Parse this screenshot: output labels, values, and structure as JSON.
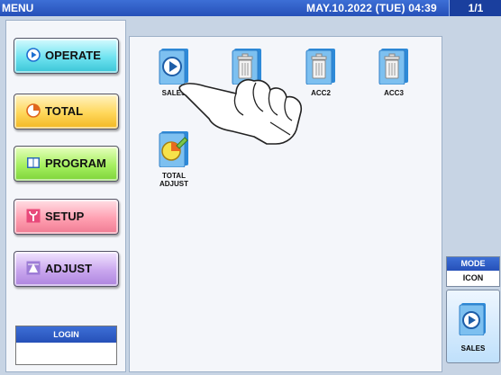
{
  "titlebar": {
    "menu_label": "MENU",
    "datetime": "MAY.10.2022 (TUE) 04:39",
    "page": "1/1"
  },
  "menu_buttons": {
    "operate": "OPERATE",
    "total": "TOTAL",
    "program": "PROGRAM",
    "setup": "SETUP",
    "adjust": "ADJUST"
  },
  "login": {
    "label": "LOGIN",
    "value": ""
  },
  "apps": [
    {
      "label": "SALES",
      "icon": "sales-play-icon"
    },
    {
      "label": "",
      "icon": "trash-icon"
    },
    {
      "label": "ACC2",
      "icon": "trash-icon"
    },
    {
      "label": "ACC3",
      "icon": "trash-icon"
    },
    {
      "label": "TOTAL\nADJUST",
      "icon": "pie-chart-pencil-icon"
    }
  ],
  "mode": {
    "label": "MODE",
    "value": "ICON"
  },
  "shortcut": {
    "label": "SALES",
    "icon": "sales-play-icon"
  },
  "colors": {
    "title_bar": "#2a56c0",
    "frame": "#c7d4e4",
    "operate": "#39c4d6",
    "total": "#f2b722",
    "program": "#7ed43a",
    "setup": "#ef7b92",
    "adjust": "#ad84de"
  }
}
